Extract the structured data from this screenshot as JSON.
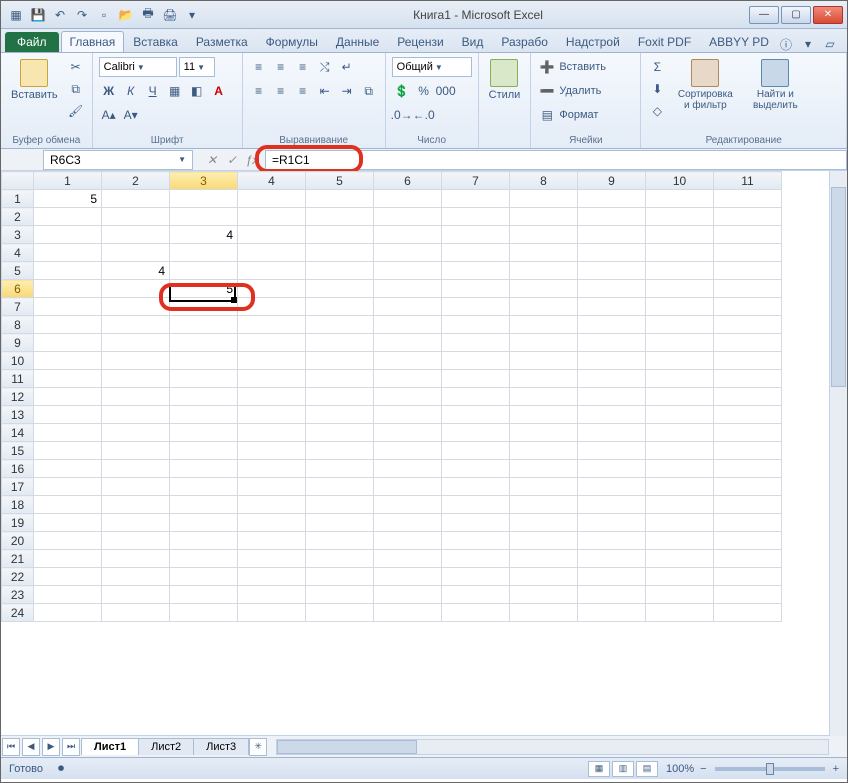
{
  "title": "Книга1  -  Microsoft Excel",
  "qat_icons": [
    "excel-icon",
    "save-icon",
    "undo-icon",
    "redo-icon",
    "new-icon",
    "open-icon",
    "print-preview-icon",
    "quick-print-icon",
    "spelling-icon",
    "sort-asc-icon",
    "sort-desc-icon",
    "dropdown-icon"
  ],
  "tabs": {
    "file": "Файл",
    "items": [
      "Главная",
      "Вставка",
      "Разметка",
      "Формулы",
      "Данные",
      "Рецензи",
      "Вид",
      "Разрабо",
      "Надстрой",
      "Foxit PDF",
      "ABBYY PD"
    ],
    "active_index": 0
  },
  "ribbon": {
    "clipboard": {
      "paste": "Вставить",
      "label": "Буфер обмена"
    },
    "font": {
      "name": "Calibri",
      "size": "11",
      "label": "Шрифт"
    },
    "alignment": {
      "label": "Выравнивание"
    },
    "number": {
      "format": "Общий",
      "label": "Число"
    },
    "styles": {
      "btn": "Стили"
    },
    "cells": {
      "insert": "Вставить",
      "delete": "Удалить",
      "format": "Формат",
      "label": "Ячейки"
    },
    "editing": {
      "sort": "Сортировка и фильтр",
      "find": "Найти и выделить",
      "label": "Редактирование"
    }
  },
  "namebox": "R6C3",
  "formula": "=R1C1",
  "columns": [
    "1",
    "2",
    "3",
    "4",
    "5",
    "6",
    "7",
    "8",
    "9",
    "10",
    "11"
  ],
  "rows": [
    "1",
    "2",
    "3",
    "4",
    "5",
    "6",
    "7",
    "8",
    "9",
    "10",
    "11",
    "12",
    "13",
    "14",
    "15",
    "16",
    "17",
    "18",
    "19",
    "20",
    "21",
    "22",
    "23",
    "24"
  ],
  "cells": {
    "r1c1": "5",
    "r3c3": "4",
    "r5c2": "4",
    "r6c3": "5"
  },
  "active": {
    "row": 6,
    "col": 3
  },
  "sheets": {
    "items": [
      "Лист1",
      "Лист2",
      "Лист3"
    ],
    "active_index": 0
  },
  "status": {
    "ready": "Готово",
    "zoom": "100%"
  },
  "chart_data": null
}
